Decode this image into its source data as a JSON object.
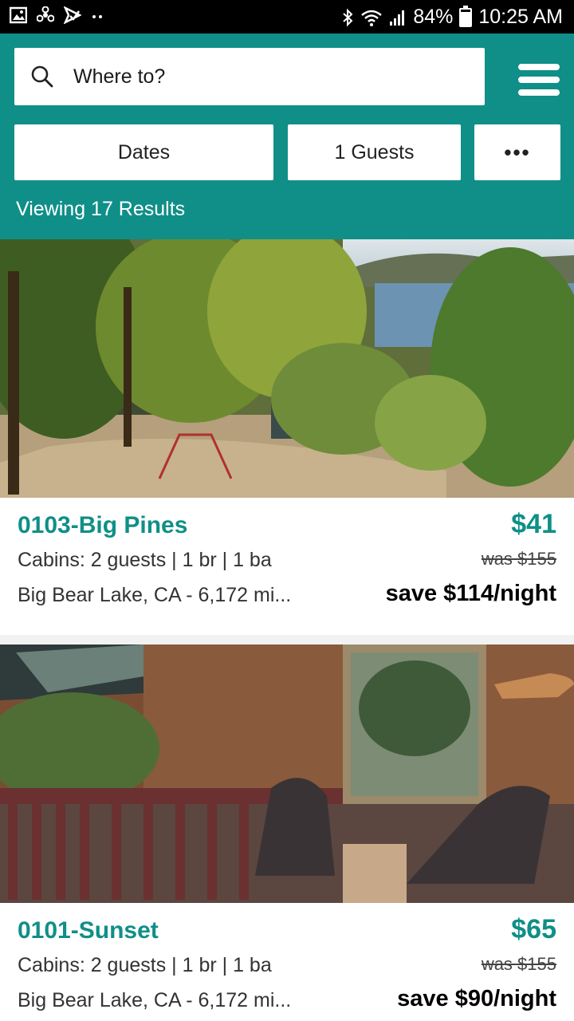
{
  "status_bar": {
    "battery": "84%",
    "time": "10:25 AM",
    "battery_level": 0.84
  },
  "search": {
    "placeholder": "Where to?"
  },
  "filters": {
    "dates_label": "Dates",
    "guests_label": "1 Guests",
    "more_label": "•••"
  },
  "results": {
    "label": "Viewing 17 Results"
  },
  "listings": [
    {
      "title": "0103-Big Pines",
      "price": "$41",
      "specs": "Cabins: 2 guests | 1 br | 1 ba",
      "location": "Big Bear Lake, CA - 6,172 mi...",
      "was": "was $155",
      "save": "save $114/night"
    },
    {
      "title": "0101-Sunset",
      "price": "$65",
      "specs": "Cabins: 2 guests | 1 br | 1 ba",
      "location": "Big Bear Lake, CA - 6,172 mi...",
      "was": "was $155",
      "save": "save $90/night"
    }
  ],
  "colors": {
    "brand_teal": "#0f8f87",
    "status_bar": "#000000"
  },
  "icons": [
    "image-icon",
    "fan-icon",
    "send-icon",
    "bluetooth-icon",
    "wifi-icon",
    "signal-icon",
    "battery-icon",
    "search-icon",
    "hamburger-menu-icon"
  ]
}
